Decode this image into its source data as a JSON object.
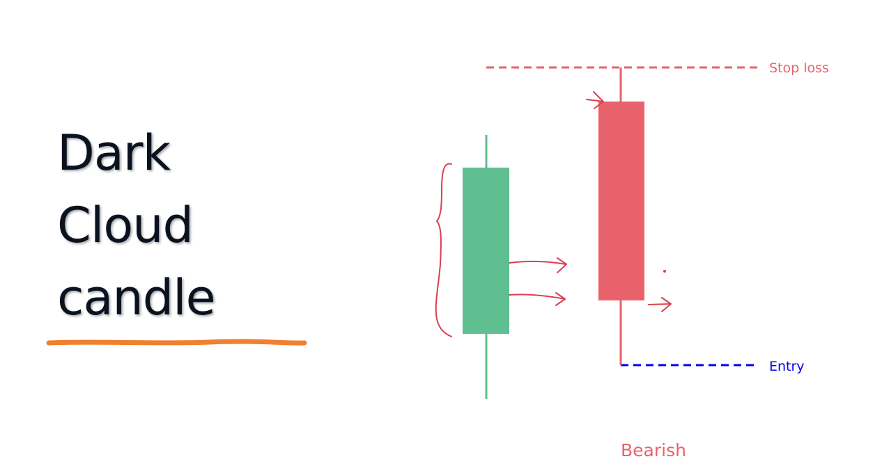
{
  "title": {
    "lines": [
      "Dark",
      "Cloud",
      "candle"
    ]
  },
  "labels": {
    "stop_loss": "Stop loss",
    "entry": "Entry",
    "pattern": "Bearish"
  },
  "colors": {
    "bullish_candle": "#5fbf90",
    "bearish_candle": "#e8626c",
    "stop_loss_line": "#e8626c",
    "entry_line": "#0000ee",
    "underline": "#f08030",
    "annotation": "#d94050",
    "title_text": "#0a1220"
  },
  "icons": [
    "brace-annotation",
    "arrow-annotation"
  ]
}
